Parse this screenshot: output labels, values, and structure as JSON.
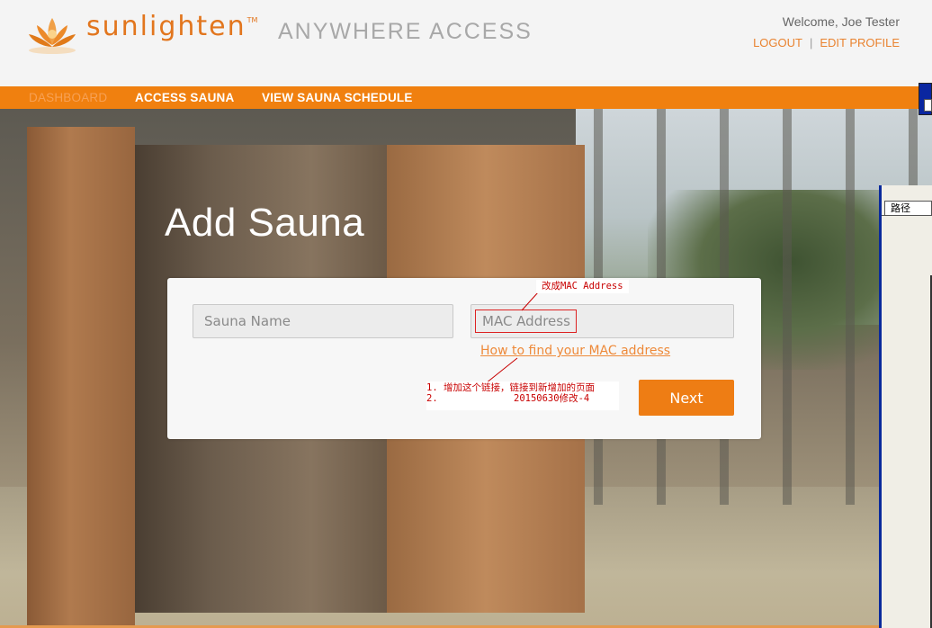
{
  "header": {
    "brand": "sunlighten",
    "brand_tm": "TM",
    "tagline": "ANYWHERE ACCESS",
    "welcome": "Welcome, Joe Tester",
    "logout": "LOGOUT",
    "edit_profile": "EDIT PROFILE"
  },
  "nav": {
    "items": [
      {
        "label": "DASHBOARD"
      },
      {
        "label": "ACCESS SAUNA"
      },
      {
        "label": "VIEW SAUNA SCHEDULE"
      }
    ]
  },
  "page": {
    "title": "Add Sauna"
  },
  "form": {
    "sauna_name_placeholder": "Sauna Name",
    "mac_placeholder": "MAC Address",
    "help_link": "How to find your MAC address",
    "next_label": "Next"
  },
  "annotations": {
    "note1": "改成MAC Address",
    "note2_line1": "1. 增加这个链接，链接到新增加的页面",
    "note2_line2": "2.",
    "note2_line2b": "20150630修改-4"
  },
  "side_panel": {
    "tab_label": "路径"
  },
  "colors": {
    "accent": "#f0800f",
    "brand": "#e2761e",
    "annotation": "#c80000"
  }
}
